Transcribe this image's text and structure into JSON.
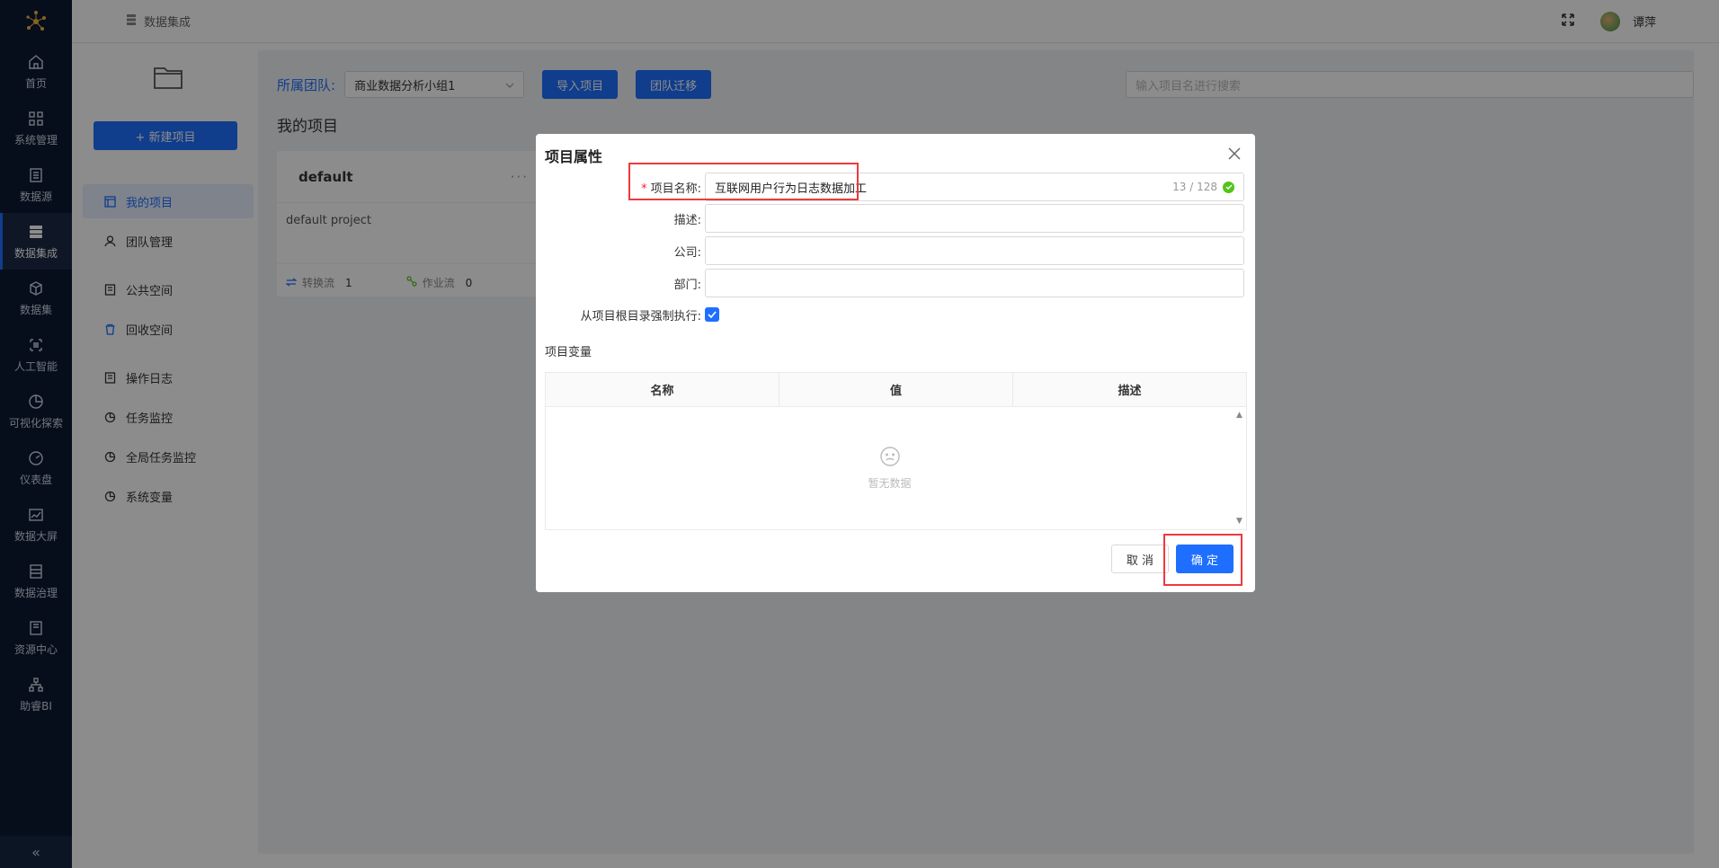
{
  "nav": {
    "items": [
      {
        "label": "首页",
        "icon": "home-icon"
      },
      {
        "label": "系统管理",
        "icon": "grid-icon"
      },
      {
        "label": "数据源",
        "icon": "file-icon"
      },
      {
        "label": "数据集成",
        "icon": "server-icon"
      },
      {
        "label": "数据集",
        "icon": "cube-icon"
      },
      {
        "label": "人工智能",
        "icon": "robot-icon"
      },
      {
        "label": "可视化探索",
        "icon": "pie-icon"
      },
      {
        "label": "仪表盘",
        "icon": "gauge-icon"
      },
      {
        "label": "数据大屏",
        "icon": "chart-icon"
      },
      {
        "label": "数据治理",
        "icon": "document-icon"
      },
      {
        "label": "资源中心",
        "icon": "book-icon"
      },
      {
        "label": "助睿BI",
        "icon": "hierarchy-icon"
      }
    ],
    "active": "数据集成",
    "collapse_glyph": "«"
  },
  "header": {
    "title": "数据集成",
    "user": "谭萍"
  },
  "sidebar": {
    "new_button": "+ 新建项目",
    "items": [
      {
        "label": "我的项目"
      },
      {
        "label": "团队管理"
      },
      {
        "label": "公共空间"
      },
      {
        "label": "回收空间"
      },
      {
        "label": "操作日志"
      },
      {
        "label": "任务监控"
      },
      {
        "label": "全局任务监控"
      },
      {
        "label": "系统变量"
      }
    ]
  },
  "toolbar": {
    "team_label": "所属团队:",
    "team_value": "商业数据分析小组1",
    "import_button": "导入项目",
    "migrate_button": "团队迁移",
    "search_placeholder": "输入项目名进行搜索"
  },
  "projects": {
    "title": "我的项目",
    "card": {
      "name": "default",
      "more": "···",
      "description": "default project",
      "transform_label": "转换流",
      "transform_count": "1",
      "job_label": "作业流",
      "job_count": "0"
    }
  },
  "modal": {
    "title": "项目属性",
    "name_label": "项目名称:",
    "name_value": "互联网用户行为日志数据加工",
    "name_count": "13 / 128",
    "desc_label": "描述:",
    "company_label": "公司:",
    "dept_label": "部门:",
    "force_label": "从项目根目录强制执行:",
    "force_checked": true,
    "vars_label": "项目变量",
    "columns": [
      "名称",
      "值",
      "描述"
    ],
    "empty_text": "暂无数据",
    "cancel": "取 消",
    "ok": "确 定"
  },
  "colors": {
    "accent": "#1e6fff",
    "nav_bg": "#0b1a33",
    "highlight": "#f0393c",
    "success": "#52c41a"
  }
}
